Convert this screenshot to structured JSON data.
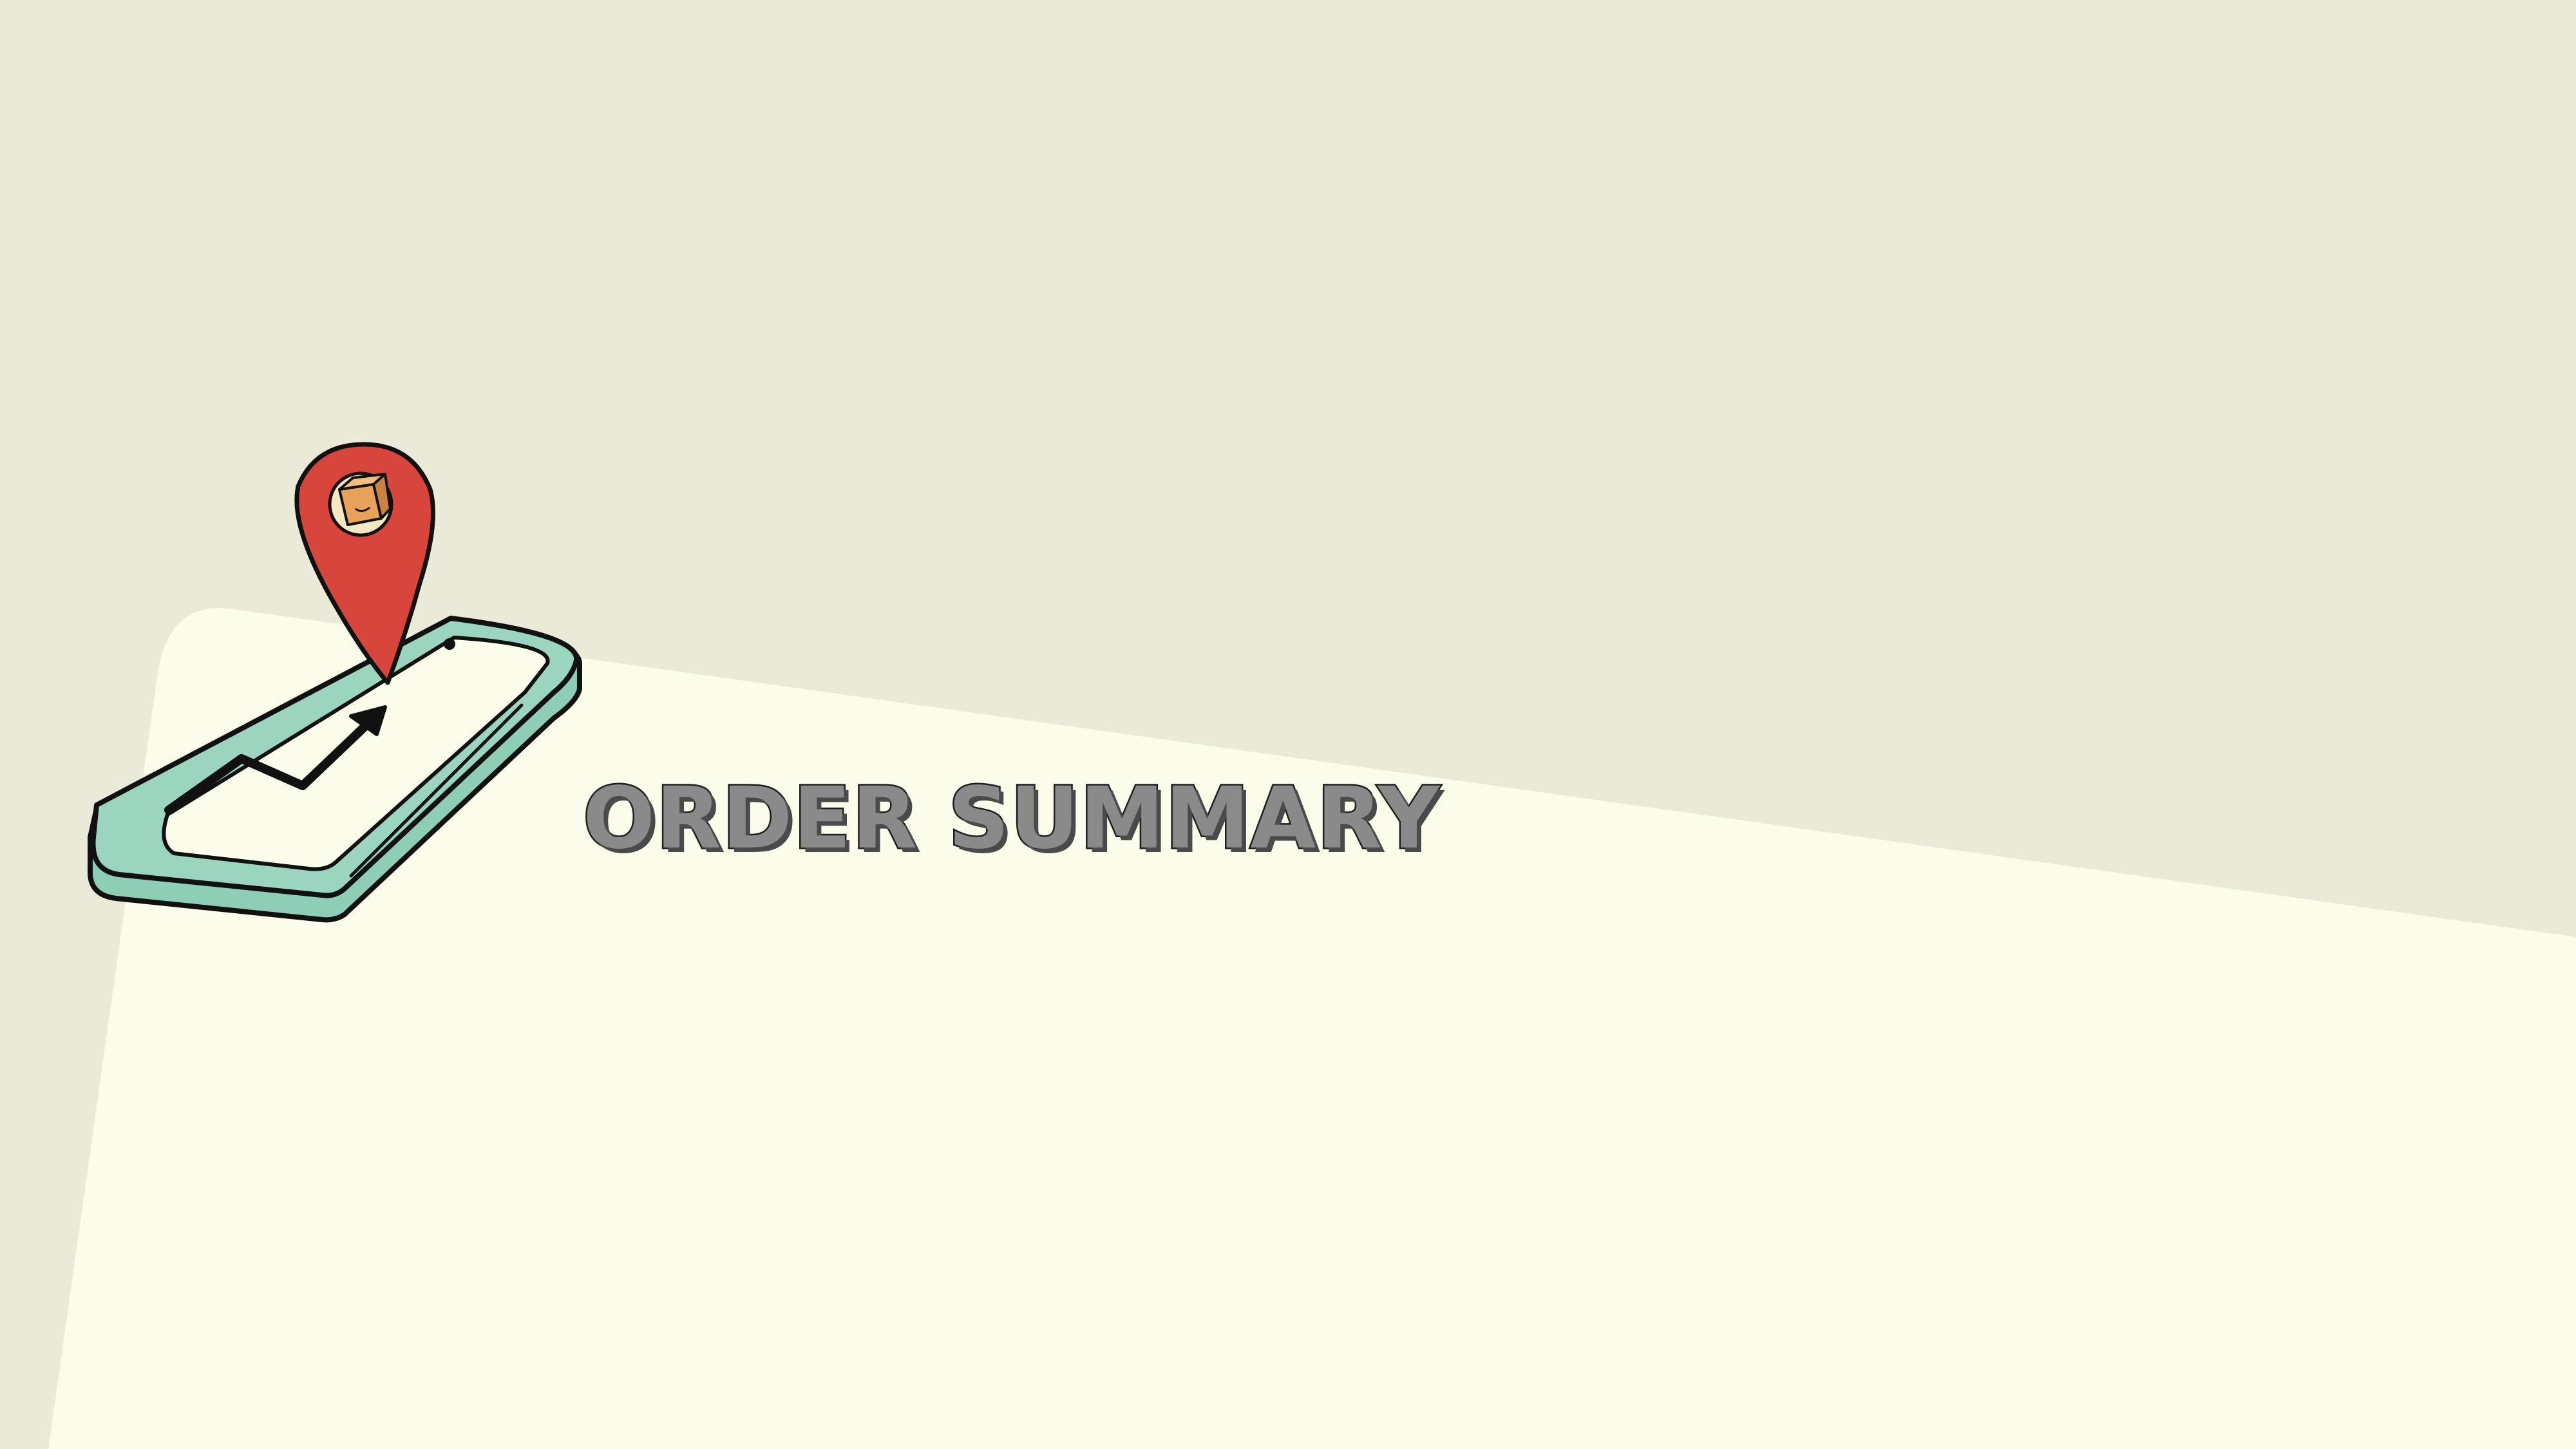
{
  "page": {
    "title": "ORDER SUMMARY"
  },
  "colors": {
    "background": "#ebead9",
    "panel": "#fcfcea",
    "phone_frame": "#8ecdb6",
    "pin": "#d8453d",
    "trend_line": "#111111",
    "title_fill": "#8a8a8a",
    "title_outline": "#1e1e1e"
  },
  "icons": [
    "smartphone-icon",
    "location-pin-icon",
    "package-icon",
    "trend-arrow-icon"
  ]
}
